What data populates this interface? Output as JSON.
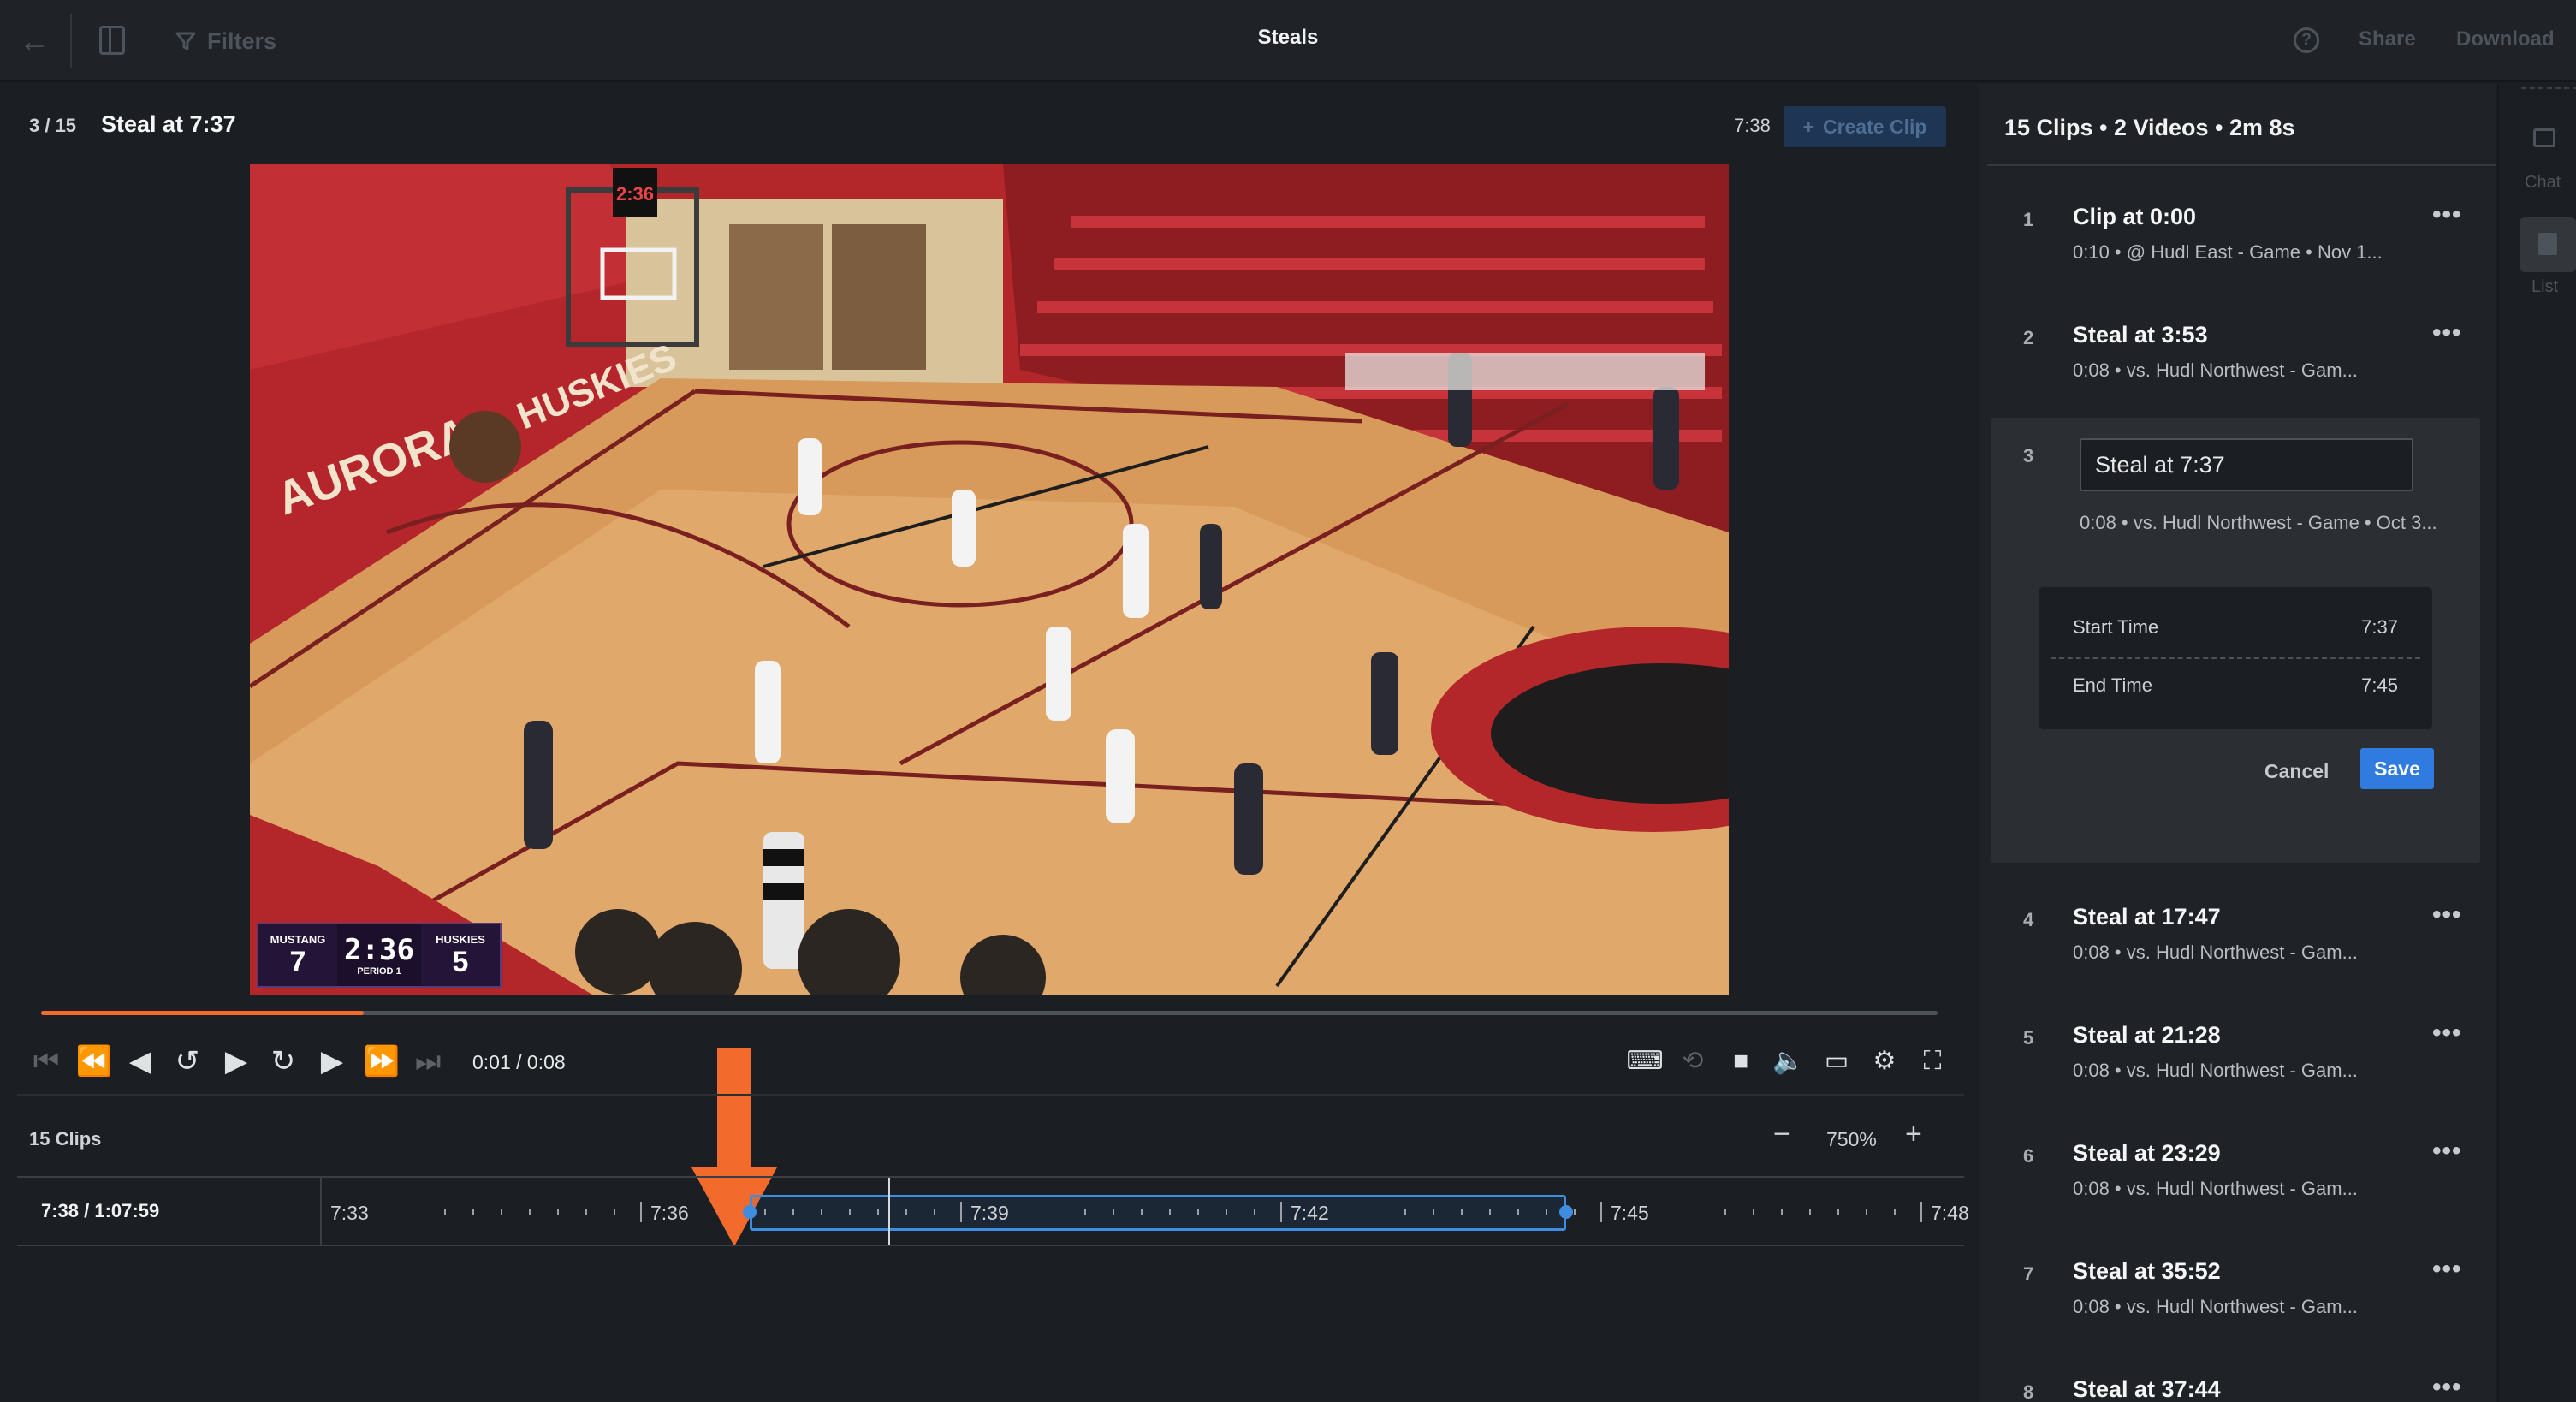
{
  "topbar": {
    "title": "Steals",
    "filters_label": "Filters",
    "share_label": "Share",
    "download_label": "Download",
    "help_glyph": "?"
  },
  "player": {
    "position": "3 / 15",
    "clip_title": "Steal at 7:37",
    "current_marker": "7:38",
    "create_clip_label": "Create Clip",
    "elapsed": "0:01 / 0:08",
    "progress_fraction": 0.17,
    "scoreboard": {
      "home_name": "MUSTANG",
      "home_score": "7",
      "clock": "2:36",
      "period_label": "PERIOD",
      "period": "1",
      "away_name": "HUSKIES",
      "away_score": "5"
    },
    "court_text": {
      "wall_left": "AURORA",
      "wall_right": "HUSKIES",
      "shot_clock": "2:36"
    },
    "accent_color": "#f26a2c"
  },
  "clips_bar": {
    "label": "15 Clips",
    "zoom": "750%",
    "zoom_minus": "−",
    "zoom_plus": "+"
  },
  "timeline": {
    "position": "7:38 / 1:07:59",
    "ticks": [
      "7:33",
      "7:36",
      "7:39",
      "7:42",
      "7:45",
      "7:48"
    ],
    "selection_start": "7:37",
    "selection_end": "7:45",
    "selection_color": "#3f8de0"
  },
  "sidebar": {
    "header": "15 Clips • 2 Videos • 2m 8s",
    "clips": [
      {
        "num": "1",
        "title": "Clip at 0:00",
        "meta": "0:10  •  @ Hudl East - Game • Nov 1..."
      },
      {
        "num": "2",
        "title": "Steal at 3:53",
        "meta": "0:08  •  vs. Hudl Northwest - Gam..."
      },
      {
        "num": "4",
        "title": "Steal at 17:47",
        "meta": "0:08  •  vs. Hudl Northwest - Gam..."
      },
      {
        "num": "5",
        "title": "Steal at 21:28",
        "meta": "0:08  •  vs. Hudl Northwest - Gam..."
      },
      {
        "num": "6",
        "title": "Steal at 23:29",
        "meta": "0:08  •  vs. Hudl Northwest - Gam..."
      },
      {
        "num": "7",
        "title": "Steal at 35:52",
        "meta": "0:08  •  vs. Hudl Northwest - Gam..."
      },
      {
        "num": "8",
        "title": "Steal at 37:44",
        "meta": ""
      }
    ],
    "editing": {
      "num": "3",
      "title_value": "Steal at 7:37",
      "meta": "0:08  •  vs. Hudl Northwest - Game • Oct 3...",
      "start_label": "Start Time",
      "start_value": "7:37",
      "end_label": "End Time",
      "end_value": "7:45",
      "cancel_label": "Cancel",
      "save_label": "Save"
    },
    "more_glyph": "•••"
  },
  "rail": {
    "chat_label": "Chat",
    "list_label": "List"
  }
}
